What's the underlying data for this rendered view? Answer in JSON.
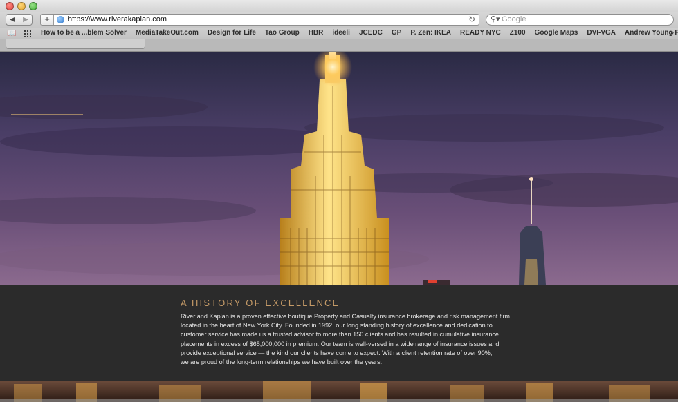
{
  "browser": {
    "url": "https://www.riverakaplan.com",
    "search_placeholder": "Google",
    "nav": {
      "back": "◀",
      "forward": "▶",
      "new_tab": "+",
      "reload": "↻"
    },
    "bookmarks": [
      "How to be a ...blem Solver",
      "MediaTakeOut.com",
      "Design for Life",
      "Tao Group",
      "HBR",
      "ideeli",
      "JCEDC",
      "GP",
      "P. Zen: IKEA",
      "READY NYC",
      "Z100",
      "Google Maps",
      "DVI-VGA",
      "Andrew Young Presents"
    ],
    "bookmarks_overflow": "»"
  },
  "page": {
    "hero_image": "empire-state-building-night-skyline",
    "section_title": "A HISTORY OF EXCELLENCE",
    "body_lines": [
      "River and Kaplan is a proven effective boutique Property and Casualty insurance brokerage and risk management firm",
      "located in the heart of New York City. Founded in 1992, our long standing history of excellence and dedication to",
      "customer service has made us a trusted advisor to more than 150 clients and has resulted in cumulative insurance",
      "placements in excess of $65,000,000 in premium. Our team is well-versed in a wide range of insurance issues and",
      "provide exceptional service — the kind our clients have come to expect. With a client retention rate of over 90%,",
      "we are proud of the long-term relationships we have built over the years."
    ],
    "colors": {
      "headline": "#c49a67",
      "panel_bg": "#2b2b2b",
      "body_text": "#e4e4e4"
    }
  }
}
